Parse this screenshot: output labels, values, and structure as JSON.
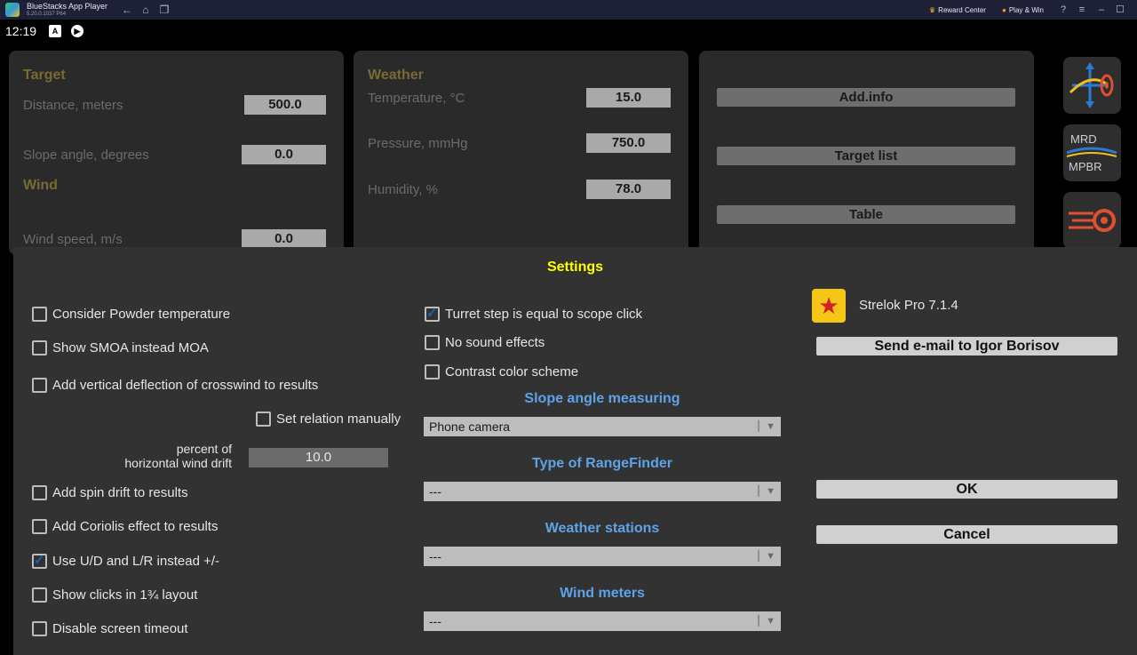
{
  "window": {
    "title": "BlueStacks App Player",
    "version": "5.20.0.1037 P64",
    "reward_center": "Reward Center",
    "play_win": "Play & Win"
  },
  "status": {
    "time": "12:19"
  },
  "target_panel": {
    "title": "Target",
    "distance_label": "Distance, meters",
    "distance_value": "500.0",
    "slope_label": "Slope angle, degrees",
    "slope_value": "0.0",
    "wind_title": "Wind",
    "wind_speed_label": "Wind speed, m/s",
    "wind_speed_value": "0.0"
  },
  "weather_panel": {
    "title": "Weather",
    "temperature_label": "Temperature, °C",
    "temperature_value": "15.0",
    "pressure_label": "Pressure, mmHg",
    "pressure_value": "750.0",
    "humidity_label": "Humidity, %",
    "humidity_value": "78.0"
  },
  "actions_panel": {
    "add_info": "Add.info",
    "target_list": "Target list",
    "table": "Table"
  },
  "side_icons": {
    "mrd_text": "MRD",
    "mpbr_text": "MPBR"
  },
  "settings": {
    "title": "Settings",
    "left_options": [
      {
        "label": "Consider Powder temperature",
        "checked": false
      },
      {
        "label": "Show SMOA instead MOA",
        "checked": false
      },
      {
        "label": "Add vertical deflection of crosswind to results",
        "checked": false
      }
    ],
    "set_relation_manually": "Set relation manually",
    "percent_label_1": "percent of",
    "percent_label_2": "horizontal wind drift",
    "percent_value": "10.0",
    "left_options_2": [
      {
        "label": "Add spin drift to results",
        "checked": false
      },
      {
        "label": "Add Coriolis effect to results",
        "checked": false
      },
      {
        "label": "Use U/D and L/R instead +/-",
        "checked": true
      },
      {
        "label": "Show clicks in 1¾ layout",
        "checked": false
      },
      {
        "label": "Disable screen timeout",
        "checked": false
      }
    ],
    "mid_options": [
      {
        "label": "Turret step is equal to scope click",
        "checked": true
      },
      {
        "label": "No sound effects",
        "checked": false
      },
      {
        "label": "Contrast color scheme",
        "checked": false
      }
    ],
    "slope_section": "Slope angle measuring",
    "slope_value": "Phone camera",
    "rangefinder_section": "Type of RangeFinder",
    "rangefinder_value": "---",
    "weather_section": "Weather stations",
    "weather_value": "---",
    "wind_section": "Wind meters",
    "wind_value": "---",
    "app_name": "Strelok Pro 7.1.4",
    "email_button": "Send e-mail to Igor Borisov",
    "ok_button": "OK",
    "cancel_button": "Cancel"
  },
  "colors": {
    "titlebar": "#1d2036",
    "panel": "#2a2a2a",
    "dialog": "#323232",
    "settings_title": "#ffff00",
    "section_title": "#5ea3e8",
    "checkbox_check": "#1565c0"
  }
}
